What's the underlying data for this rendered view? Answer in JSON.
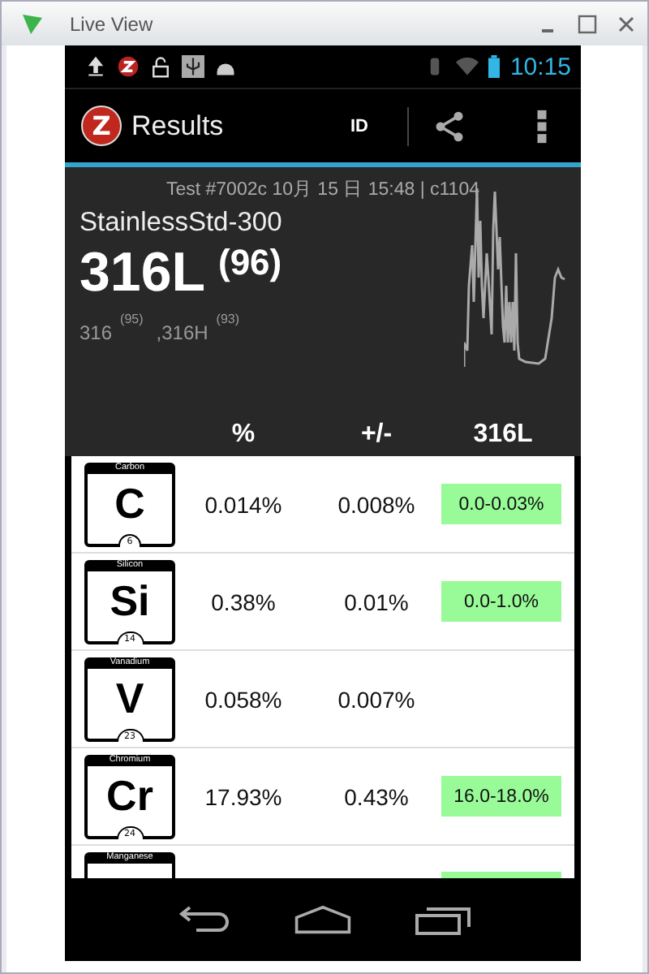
{
  "window": {
    "title": "Live View"
  },
  "status_bar": {
    "time": "10:15"
  },
  "action_bar": {
    "logo": "Z",
    "title": "Results",
    "id_button": "ID"
  },
  "summary": {
    "test_line": "Test #7002c 10月 15 日 15:48  | c1104",
    "material": "StainlessStd-300",
    "grade": "316L",
    "grade_score": "(96)",
    "alternatives": [
      {
        "grade": "316",
        "score": "(95)"
      },
      {
        "grade": ",316H",
        "score": "(93)"
      }
    ]
  },
  "table": {
    "columns": [
      "%",
      "+/-",
      "316L"
    ],
    "rows": [
      {
        "name": "Carbon",
        "symbol": "C",
        "number": "6",
        "percent": "0.014%",
        "error": "0.008%",
        "range": "0.0-0.03%",
        "in_spec": true
      },
      {
        "name": "Silicon",
        "symbol": "Si",
        "number": "14",
        "percent": "0.38%",
        "error": "0.01%",
        "range": "0.0-1.0%",
        "in_spec": true
      },
      {
        "name": "Vanadium",
        "symbol": "V",
        "number": "23",
        "percent": "0.058%",
        "error": "0.007%",
        "in_spec": false
      },
      {
        "name": "Chromium",
        "symbol": "Cr",
        "number": "24",
        "percent": "17.93%",
        "error": "0.43%",
        "range": "16.0-18.0%",
        "in_spec": true
      },
      {
        "name": "Manganese",
        "in_spec": true
      }
    ]
  }
}
